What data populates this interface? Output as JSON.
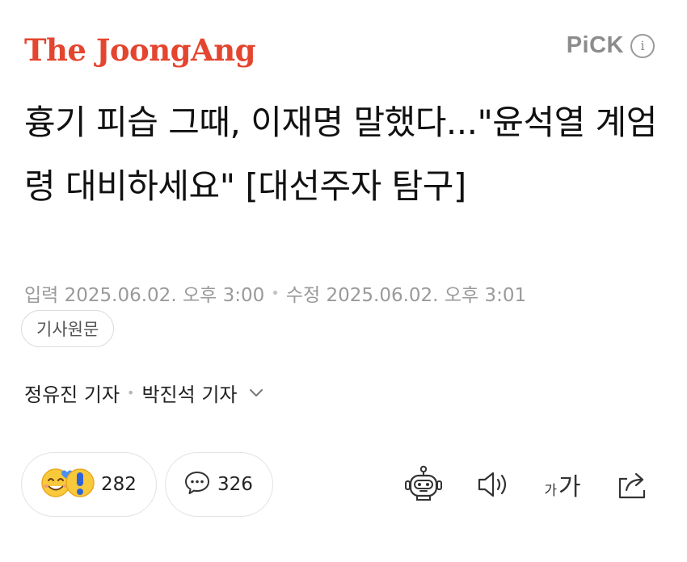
{
  "header": {
    "logo": "The JoongAng",
    "pick_label": "PiCK",
    "info_glyph": "i"
  },
  "article": {
    "headline": "흉기 피습 그때, 이재명 말했다...\"윤석열 계엄령 대비하세요\" [대선주자 탐구]",
    "published": "입력 2025.06.02. 오후 3:00",
    "modified": "수정 2025.06.02. 오후 3:01",
    "original_button": "기사원문",
    "reporters": [
      "정유진 기자",
      "박진석 기자"
    ]
  },
  "actions": {
    "reaction_count": "282",
    "comment_count": "326",
    "font_small": "가",
    "font_big": "가"
  },
  "colors": {
    "logo": "#e4452f",
    "muted": "#9a9a9a"
  },
  "icons": [
    "smile-emoji-icon",
    "heart-icon",
    "exclamation-icon",
    "comment-bubble-icon",
    "robot-summary-icon",
    "speaker-icon",
    "font-size-icon",
    "share-icon",
    "chevron-down-icon",
    "info-icon"
  ]
}
